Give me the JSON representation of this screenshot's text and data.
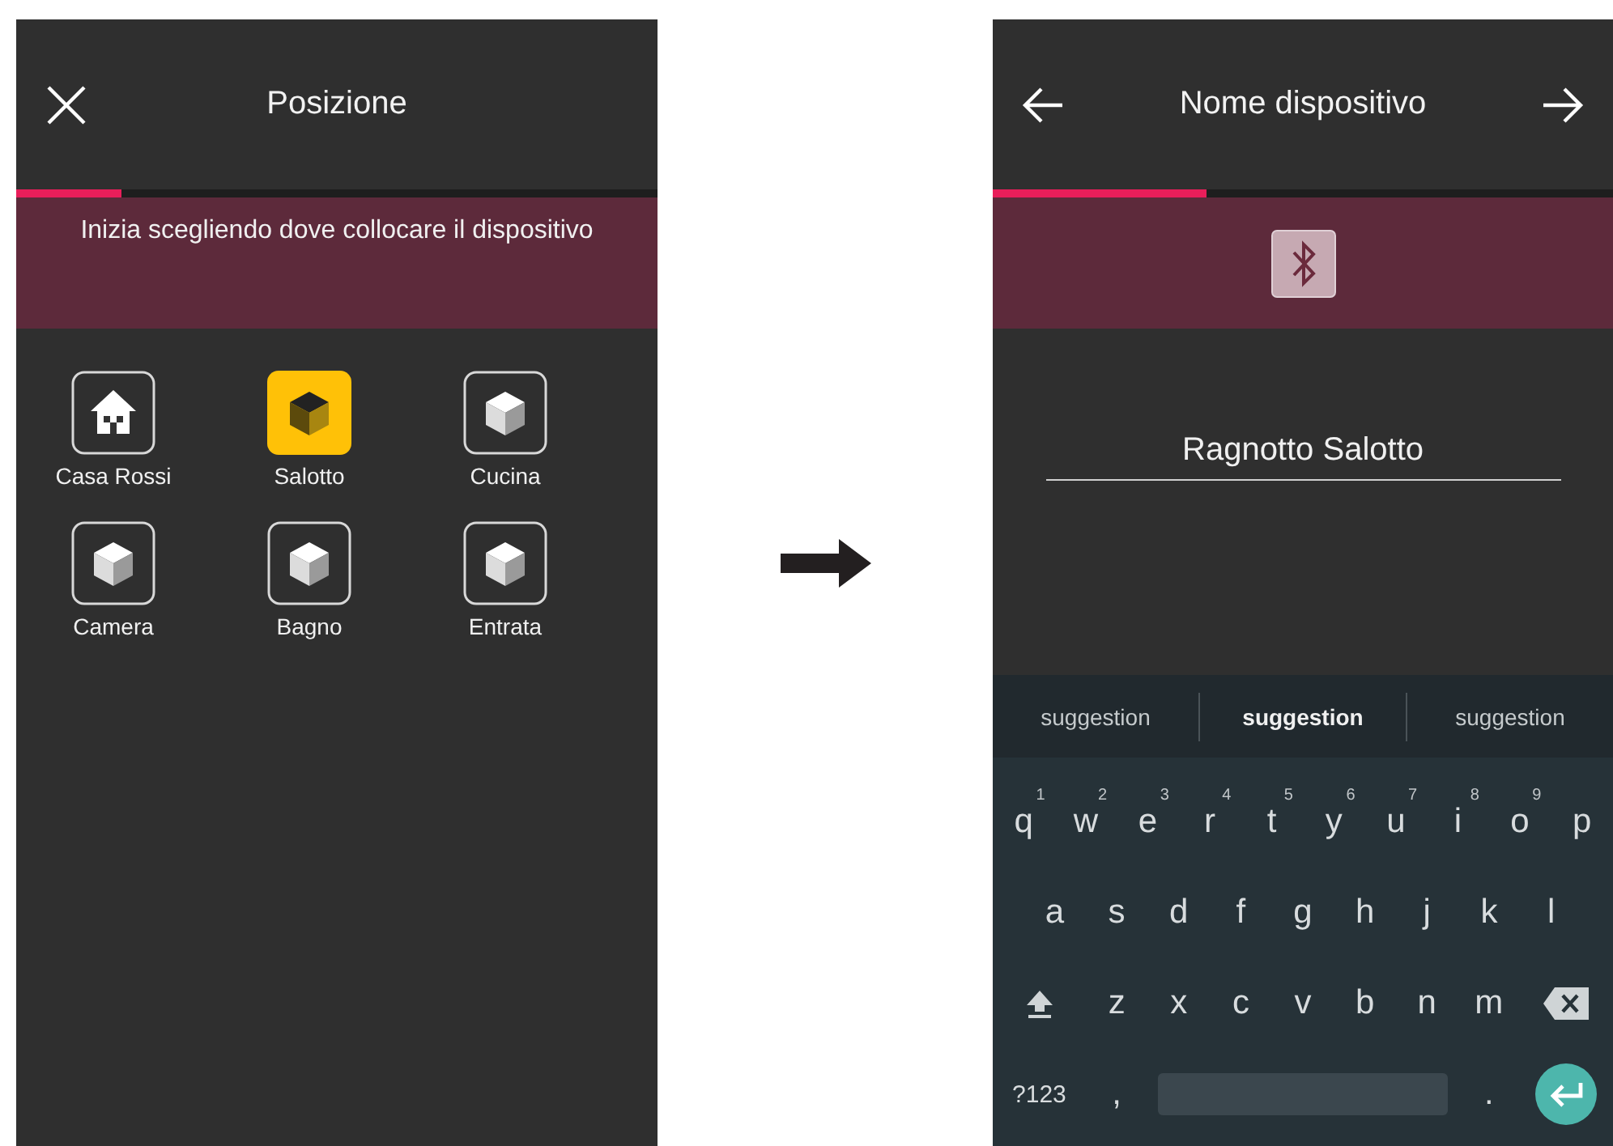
{
  "left_screen": {
    "title": "Posizione",
    "progress": {
      "level": 0.165
    },
    "instruction": "Inizia scegliendo dove collocare il dispositivo",
    "rooms": [
      {
        "label": "Casa Rossi",
        "kind": "home",
        "selected": false
      },
      {
        "label": "Salotto",
        "kind": "room",
        "selected": true
      },
      {
        "label": "Cucina",
        "kind": "room",
        "selected": false
      },
      {
        "label": "Camera",
        "kind": "room",
        "selected": false
      },
      {
        "label": "Bagno",
        "kind": "room",
        "selected": false
      },
      {
        "label": "Entrata",
        "kind": "room",
        "selected": false
      }
    ]
  },
  "right_screen": {
    "title": "Nome dispositivo",
    "progress": {
      "level": 0.345
    },
    "device_name": {
      "value": "Ragnotto Salotto"
    },
    "keyboard": {
      "suggestions": [
        {
          "text": "suggestion",
          "selected": false
        },
        {
          "text": "suggestion",
          "selected": true
        },
        {
          "text": "suggestion",
          "selected": false
        }
      ],
      "key_rows": [
        {
          "keys": [
            {
              "kind": "letter",
              "label": "q",
              "hint": "1"
            },
            {
              "kind": "letter",
              "label": "w",
              "hint": "2"
            },
            {
              "kind": "letter",
              "label": "e",
              "hint": "3"
            },
            {
              "kind": "letter",
              "label": "r",
              "hint": "4"
            },
            {
              "kind": "letter",
              "label": "t",
              "hint": "5"
            },
            {
              "kind": "letter",
              "label": "y",
              "hint": "6"
            },
            {
              "kind": "letter",
              "label": "u",
              "hint": "7"
            },
            {
              "kind": "letter",
              "label": "i",
              "hint": "8"
            },
            {
              "kind": "letter",
              "label": "o",
              "hint": "9"
            },
            {
              "kind": "letter",
              "label": "p"
            }
          ]
        },
        {
          "keys": [
            {
              "kind": "letter",
              "label": "a"
            },
            {
              "kind": "letter",
              "label": "s"
            },
            {
              "kind": "letter",
              "label": "d"
            },
            {
              "kind": "letter",
              "label": "f"
            },
            {
              "kind": "letter",
              "label": "g"
            },
            {
              "kind": "letter",
              "label": "h"
            },
            {
              "kind": "letter",
              "label": "j"
            },
            {
              "kind": "letter",
              "label": "k"
            },
            {
              "kind": "letter",
              "label": "l"
            }
          ]
        },
        {
          "keys": [
            {
              "kind": "shift"
            },
            {
              "kind": "letter",
              "label": "z"
            },
            {
              "kind": "letter",
              "label": "x"
            },
            {
              "kind": "letter",
              "label": "c"
            },
            {
              "kind": "letter",
              "label": "v"
            },
            {
              "kind": "letter",
              "label": "b"
            },
            {
              "kind": "letter",
              "label": "n"
            },
            {
              "kind": "letter",
              "label": "m"
            },
            {
              "kind": "backspace"
            }
          ]
        },
        {
          "keys": [
            {
              "kind": "symbols",
              "label": "?123"
            },
            {
              "kind": "letter",
              "label": ","
            },
            {
              "kind": "space"
            },
            {
              "kind": "letter",
              "label": "."
            },
            {
              "kind": "enter"
            }
          ]
        }
      ]
    }
  }
}
